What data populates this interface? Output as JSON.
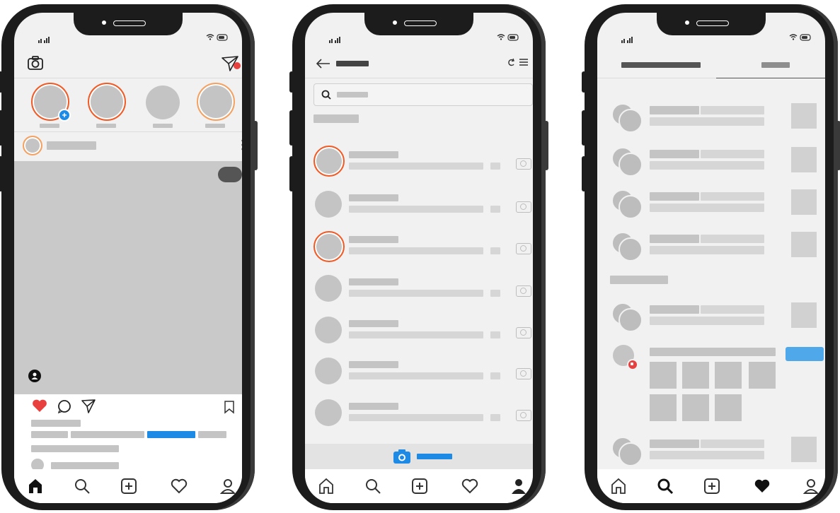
{
  "screens": [
    {
      "name": "feed",
      "has_like": true,
      "has_notification_dot": true
    },
    {
      "name": "direct-messages"
    },
    {
      "name": "activity",
      "follow_button_color": "#4fa8ea"
    }
  ],
  "colors": {
    "accent_blue": "#1d8ae6",
    "like_red": "#e8403f",
    "story_ring": "#f15a24",
    "placeholder": "#c4c4c4",
    "frame": "#1c1c1c"
  },
  "icons": {
    "feed_top_left": "camera-icon",
    "feed_top_right": "direct-message-icon",
    "post_actions": [
      "heart-icon",
      "comment-icon",
      "share-icon",
      "bookmark-icon"
    ],
    "nav": [
      "home-icon",
      "search-icon",
      "add-post-icon",
      "heart-icon",
      "profile-icon"
    ]
  }
}
